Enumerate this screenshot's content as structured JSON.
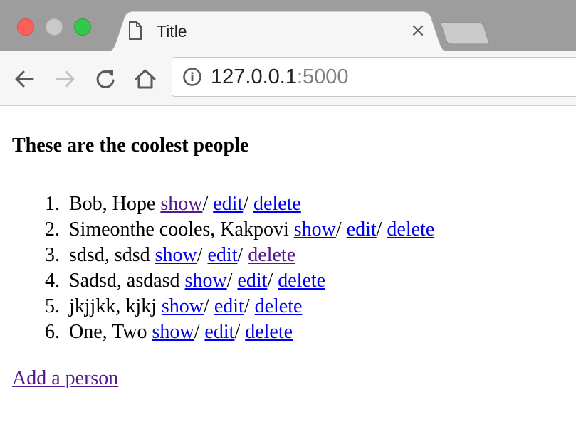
{
  "browser": {
    "tab_title": "Title",
    "tab_close_glyph": "×",
    "url_host": "127.0.0.1",
    "url_port": ":5000",
    "icons": {
      "back": "back-arrow-icon",
      "forward": "forward-arrow-icon",
      "reload": "reload-icon",
      "home": "home-icon",
      "info": "info-icon",
      "page": "page-icon"
    }
  },
  "page": {
    "heading": "These are the coolest people",
    "people": [
      {
        "num": "1.",
        "name": "Bob, Hope",
        "show": "show",
        "edit": "edit",
        "delete": "delete"
      },
      {
        "num": "2.",
        "name": "Simeonthe cooles, Kakpovi",
        "show": "show",
        "edit": "edit",
        "delete": "delete"
      },
      {
        "num": "3.",
        "name": "sdsd, sdsd",
        "show": "show",
        "edit": "edit",
        "delete": "delete"
      },
      {
        "num": "4.",
        "name": "Sadsd, asdasd",
        "show": "show",
        "edit": "edit",
        "delete": "delete"
      },
      {
        "num": "5.",
        "name": "jkjjkk, kjkj",
        "show": "show",
        "edit": "edit",
        "delete": "delete"
      },
      {
        "num": "6.",
        "name": "One, Two",
        "show": "show",
        "edit": "edit",
        "delete": "delete"
      }
    ],
    "separator": "/",
    "add_link": "Add a person"
  },
  "colors": {
    "link": "#0000ee",
    "visited_link": "#551a8b"
  }
}
